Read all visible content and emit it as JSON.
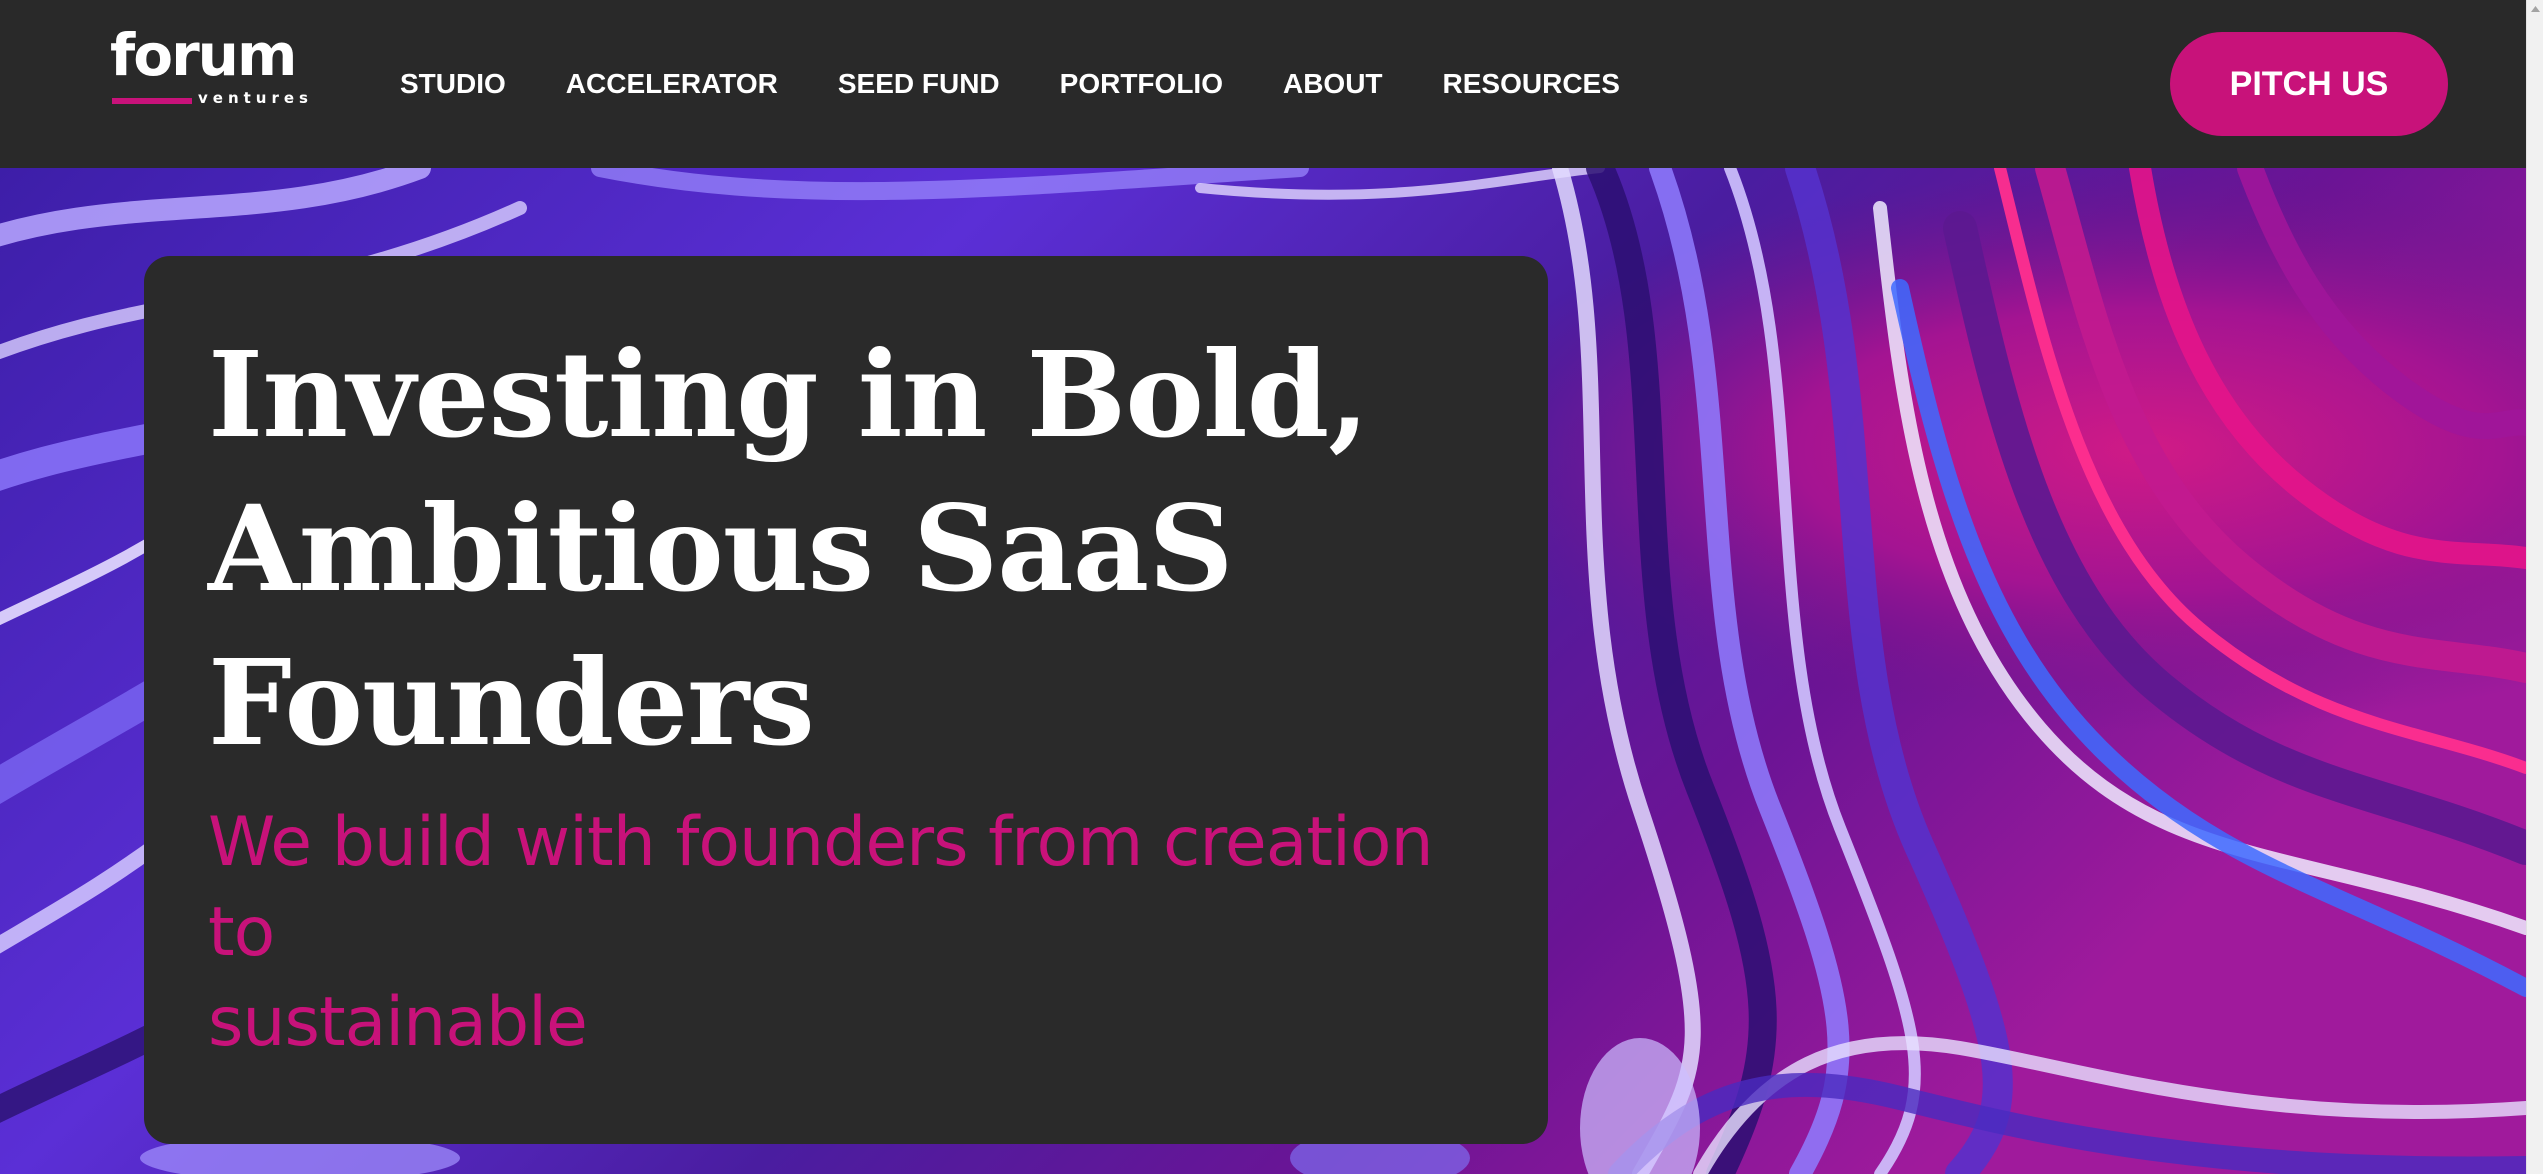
{
  "brand": {
    "logo_word": "forum",
    "logo_sub": "ventures"
  },
  "nav": {
    "items": [
      {
        "label": "STUDIO"
      },
      {
        "label": "ACCELERATOR"
      },
      {
        "label": "SEED FUND"
      },
      {
        "label": "PORTFOLIO"
      },
      {
        "label": "ABOUT"
      },
      {
        "label": "RESOURCES"
      }
    ],
    "cta_label": "PITCH US"
  },
  "hero": {
    "title_line1": "Investing in Bold,",
    "title_line2": "Ambitious SaaS",
    "title_line3": "Founders",
    "subtitle_line1": "We build with founders from creation to",
    "subtitle_line2": "sustainable"
  },
  "colors": {
    "accent": "#c8127a",
    "nav_background": "#292929",
    "card_background": "#2a2a2a",
    "text_primary": "#ffffff"
  },
  "icons": {
    "scroll_up": "scroll-up-arrow-icon"
  }
}
